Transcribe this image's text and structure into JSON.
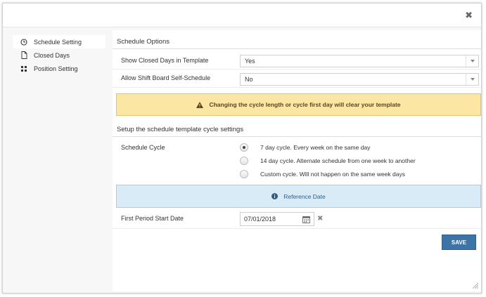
{
  "dialog": {
    "close_glyph": "✖"
  },
  "sidebar": {
    "items": [
      {
        "label": "Schedule Setting",
        "icon": "clock-icon",
        "active": true
      },
      {
        "label": "Closed Days",
        "icon": "file-icon",
        "active": false
      },
      {
        "label": "Position Setting",
        "icon": "grid-icon",
        "active": false
      }
    ]
  },
  "schedule_options": {
    "header": "Schedule Options",
    "show_closed_days": {
      "label": "Show Closed Days in Template",
      "value": "Yes"
    },
    "allow_self_schedule": {
      "label": "Allow Shift Board Self-Schedule",
      "value": "No"
    }
  },
  "warning": {
    "text": "Changing the cycle length or cycle first day will clear your template"
  },
  "cycle_settings": {
    "header": "Setup the schedule template cycle settings",
    "label": "Schedule Cycle",
    "options": [
      {
        "label": "7 day cycle. Every week on the same day",
        "checked": true
      },
      {
        "label": "14 day cycle. Alternate schedule from one week to another",
        "checked": false
      },
      {
        "label": "Custom cycle. Will not happen on the same week days",
        "checked": false
      }
    ]
  },
  "reference": {
    "text": "Reference Date"
  },
  "first_period": {
    "label": "First Period Start Date",
    "value": "07/01/2018"
  },
  "actions": {
    "save_label": "SAVE"
  },
  "colors": {
    "accent": "#3c74a8",
    "warning_bg": "#fbe6a4",
    "info_bg": "#d9ebf7"
  }
}
